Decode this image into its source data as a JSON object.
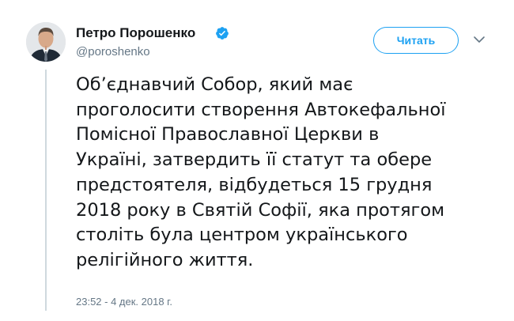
{
  "author": {
    "name": "Петро Порошенко",
    "handle": "@poroshenko",
    "verified": true
  },
  "follow_button": {
    "label": "Читать"
  },
  "tweet": {
    "lines": [
      "Об’єднавчий Собор, який має",
      "проголосити створення Автокефальної",
      "Помісної Православної Церкви в",
      "Україні, затвердить її статут та обере",
      "предстоятеля, відбудеться 15 грудня",
      "2018 року в Святій Софії, яка протягом",
      "століть була центром українського",
      "релігійного життя."
    ],
    "timestamp": "23:52 - 4 дек. 2018 г."
  },
  "colors": {
    "accent": "#1da1f2",
    "text": "#14171a",
    "secondary_text": "#657786",
    "thread_line": "#cfd9de"
  },
  "icons": {
    "verified": "verified-badge-icon",
    "menu": "chevron-down-icon"
  }
}
